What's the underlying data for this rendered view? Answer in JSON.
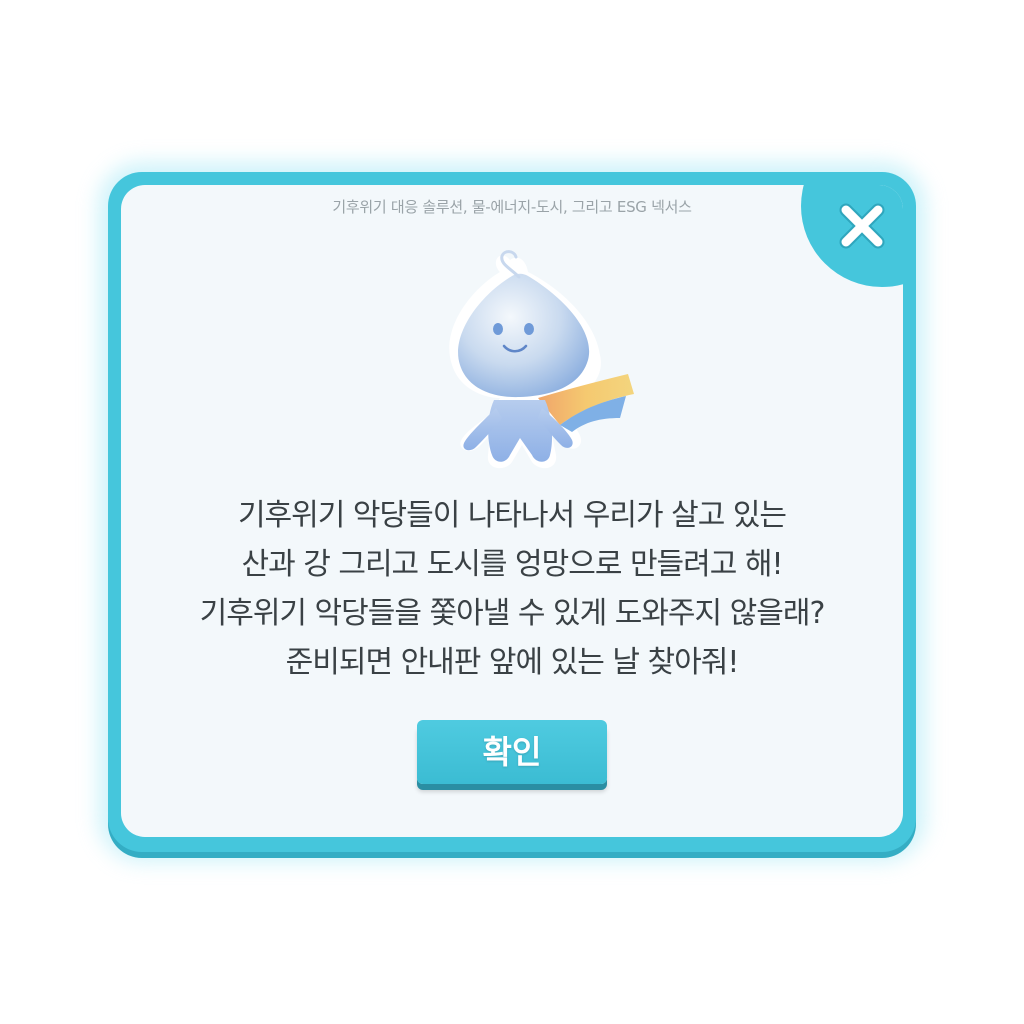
{
  "dialog": {
    "subtitle": "기후위기 대응 솔루션, 물-에너지-도시, 그리고 ESG 넥서스",
    "message_lines": [
      "기후위기 악당들이 나타나서 우리가 살고 있는",
      "산과 강 그리고 도시를 엉망으로 만들려고 해!",
      "기후위기 악당들을 쫓아낼 수 있게 도와주지 않을래?",
      "준비되면 안내판 앞에 있는 날 찾아줘!"
    ],
    "confirm_label": "확인",
    "close_icon": "close-icon",
    "mascot_icon": "water-drop-mascot"
  },
  "colors": {
    "frame": "#45c6dc",
    "panel": "#f3f8fb",
    "text": "#3a4145",
    "subtitle": "#9aa3a8",
    "button": "#45c6dc"
  }
}
